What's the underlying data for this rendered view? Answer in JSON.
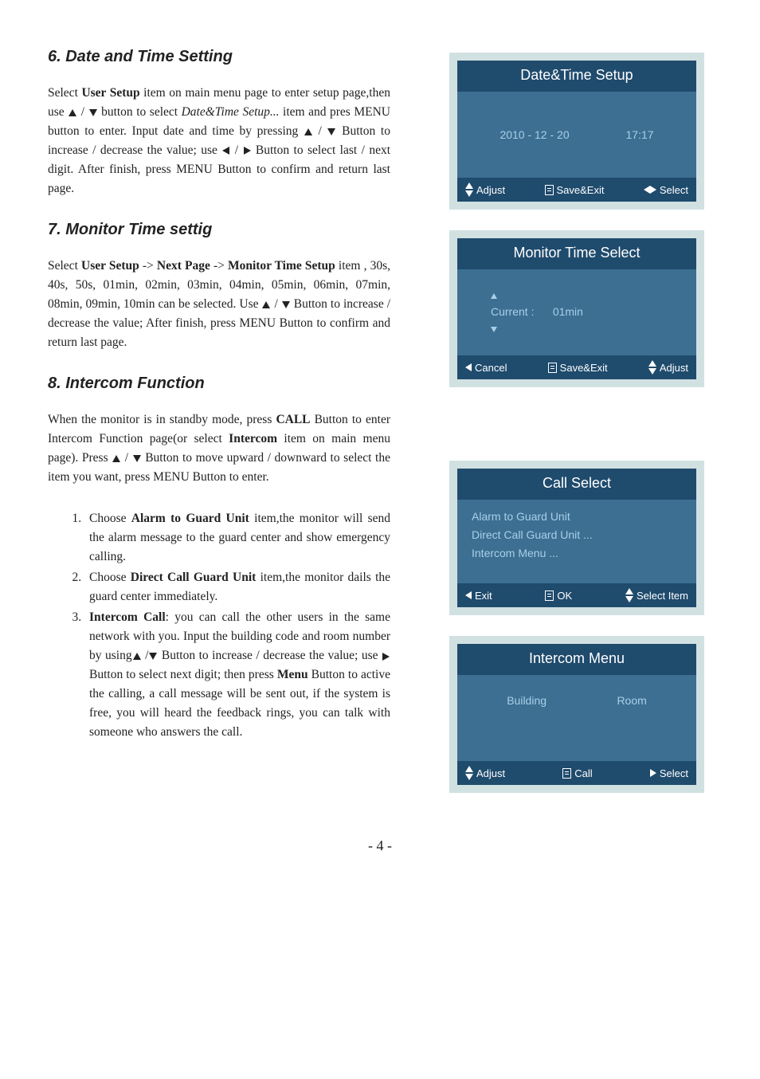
{
  "sections": {
    "s6": {
      "heading": "6. Date and Time Setting",
      "body_a": "Select ",
      "body_b": "User Setup",
      "body_c": " item on main menu page to enter setup page,then use ",
      "body_d": " / ",
      "body_e": " button to select ",
      "body_f": "Date&Time Setup...",
      "body_g": " item and pres MENU button to enter. Input date and time by pressing ",
      "body_h": " / ",
      "body_i": " Button to increase / decrease the value; use ",
      "body_j": " / ",
      "body_k": " Button to select last / next digit. After finish, press MENU Button to confirm and return last page."
    },
    "s7": {
      "heading": "7. Monitor Time settig",
      "body_a": "Select ",
      "body_b": "User Setup",
      "body_c": " -> ",
      "body_d": "Next Page",
      "body_e": " -> ",
      "body_f": "Monitor Time Setup",
      "body_g": " item , 30s, 40s, 50s, 01min, 02min, 03min, 04min, 05min, 06min, 07min, 08min, 09min, 10min can be selected. Use ",
      "body_h": " / ",
      "body_i": " Button to increase / decrease the value;  After finish, press MENU Button to confirm and return last page."
    },
    "s8": {
      "heading": "8. Intercom Function",
      "intro_a": "When the monitor is in standby mode, press ",
      "intro_b": "CALL",
      "intro_c": " Button to enter Intercom Function page(or select ",
      "intro_d": "Intercom",
      "intro_e": " item on main menu page). Press   ",
      "intro_f": "  / ",
      "intro_g": " Button to move upward / downward to select the item you want, press MENU Button to enter.",
      "li1_a": "Choose ",
      "li1_b": "Alarm to Guard Unit",
      "li1_c": " item,the monitor will send the alarm message to the guard center and show emergency calling.",
      "li2_a": "Choose ",
      "li2_b": "Direct Call Guard Unit",
      "li2_c": " item,the monitor dails the guard center immediately.",
      "li3_a": "Intercom Call",
      "li3_b": ": you can call the other users in the same network with you. Input the building code and room number by using",
      "li3_c": " /",
      "li3_d": " Button to increase / decrease the value; use   ",
      "li3_e": "  Button to select next digit; then press ",
      "li3_f": "Menu",
      "li3_g": " Button to active the calling, a call message will be sent out, if the system is free, you will heard the feedback rings, you can talk with someone who answers the call."
    }
  },
  "panels": {
    "datetime": {
      "title": "Date&Time Setup",
      "date": "2010 - 12 - 20",
      "time": "17:17",
      "foot_adjust": "Adjust",
      "foot_save": "Save&Exit",
      "foot_select": "Select"
    },
    "monitor": {
      "title": "Monitor Time Select",
      "current_label": "Current :",
      "current_value": "01min",
      "foot_cancel": "Cancel",
      "foot_save": "Save&Exit",
      "foot_adjust": "Adjust"
    },
    "call": {
      "title": "Call Select",
      "line1": "Alarm to Guard Unit",
      "line2": "Direct Call  Guard Unit ...",
      "line3": "Intercom Menu ...",
      "foot_exit": "Exit",
      "foot_ok": "OK",
      "foot_select": "Select Item"
    },
    "intercom": {
      "title": "Intercom Menu",
      "col1": "Building",
      "col2": "Room",
      "foot_adjust": "Adjust",
      "foot_call": "Call",
      "foot_select": "Select"
    }
  },
  "page_number": "- 4 -"
}
